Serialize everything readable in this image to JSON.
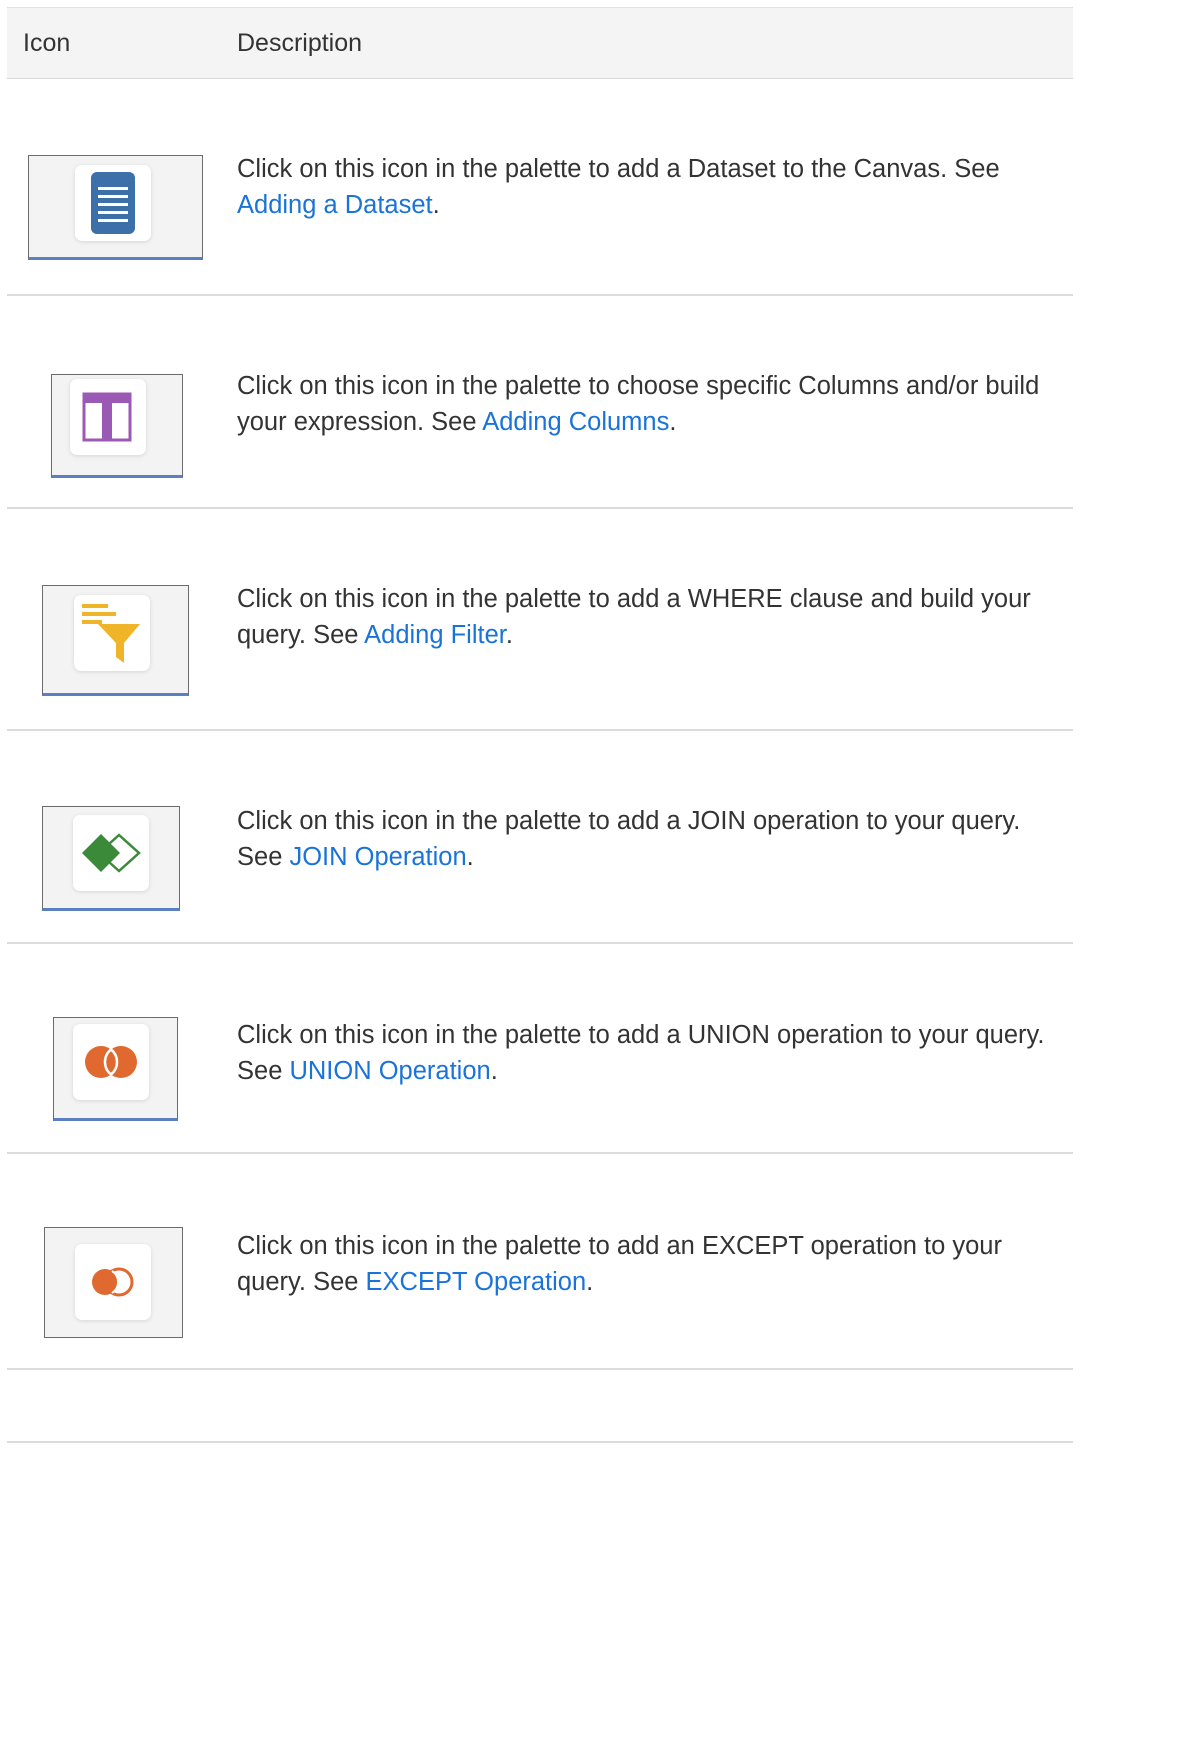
{
  "table": {
    "header": {
      "icon": "Icon",
      "description": "Description"
    },
    "rows": [
      {
        "icon": "dataset-icon",
        "icon_color": "#3d6fa8",
        "text_before": "Click on this icon in the palette to add a Dataset to the Canvas. See ",
        "link": "Adding a Dataset",
        "text_after": "."
      },
      {
        "icon": "columns-icon",
        "icon_color": "#9b59b6",
        "text_before": "Click on this icon in the palette to choose specific Columns and/or build your expression. See ",
        "link": "Adding Columns",
        "text_after": "."
      },
      {
        "icon": "filter-icon",
        "icon_color": "#f0b429",
        "text_before": "Click on this icon in the palette to add a WHERE clause and build your query. See ",
        "link": "Adding Filter",
        "text_after": "."
      },
      {
        "icon": "join-icon",
        "icon_color": "#3a8a3a",
        "text_before": "Click on this icon in the palette to add a JOIN operation to your query. See ",
        "link": "JOIN Operation",
        "text_after": "."
      },
      {
        "icon": "union-icon",
        "icon_color": "#e0692f",
        "text_before": "Click on this icon in the palette to add a UNION operation to your query. See ",
        "link": "UNION Operation",
        "text_after": "."
      },
      {
        "icon": "except-icon",
        "icon_color": "#e0692f",
        "text_before": "Click on this icon in the palette to add an EXCEPT operation to your query. See ",
        "link": "EXCEPT Operation",
        "text_after": "."
      }
    ]
  }
}
